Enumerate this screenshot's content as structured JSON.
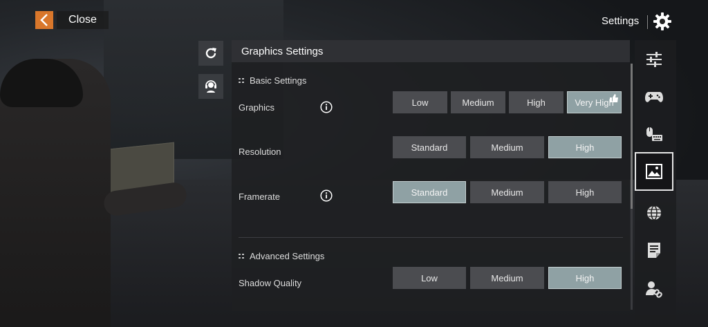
{
  "top_bar": {
    "close_label": "Close",
    "settings_label": "Settings",
    "back_icon": "chevron-left-icon",
    "gear_icon": "gear-icon"
  },
  "side_buttons": [
    {
      "icon": "reset-icon"
    },
    {
      "icon": "support-icon"
    }
  ],
  "panel": {
    "title": "Graphics Settings",
    "sections": [
      {
        "title": "Basic Settings",
        "rows": [
          {
            "label": "Graphics",
            "info": true,
            "options": [
              "Low",
              "Medium",
              "High",
              "Very High"
            ],
            "selected": 3,
            "recommended": 3
          },
          {
            "label": "Resolution",
            "info": false,
            "options": [
              "Standard",
              "Medium",
              "High"
            ],
            "selected": 2
          },
          {
            "label": "Framerate",
            "info": true,
            "options": [
              "Standard",
              "Medium",
              "High"
            ],
            "selected": 0
          }
        ]
      },
      {
        "title": "Advanced Settings",
        "rows": [
          {
            "label": "Shadow Quality",
            "info": false,
            "options": [
              "Low",
              "Medium",
              "High"
            ],
            "selected": 2
          }
        ]
      }
    ]
  },
  "rail": [
    {
      "icon": "sliders-icon",
      "active": false
    },
    {
      "icon": "gamepad-icon",
      "active": false
    },
    {
      "icon": "mouse-keyboard-icon",
      "active": false
    },
    {
      "icon": "image-icon",
      "active": true
    },
    {
      "icon": "globe-icon",
      "active": false
    },
    {
      "icon": "document-icon",
      "active": false
    },
    {
      "icon": "account-link-icon",
      "active": false
    }
  ],
  "colors": {
    "accent_orange": "#d9772b",
    "selected_option": "#8fa1a4",
    "option": "#4b4c50"
  }
}
